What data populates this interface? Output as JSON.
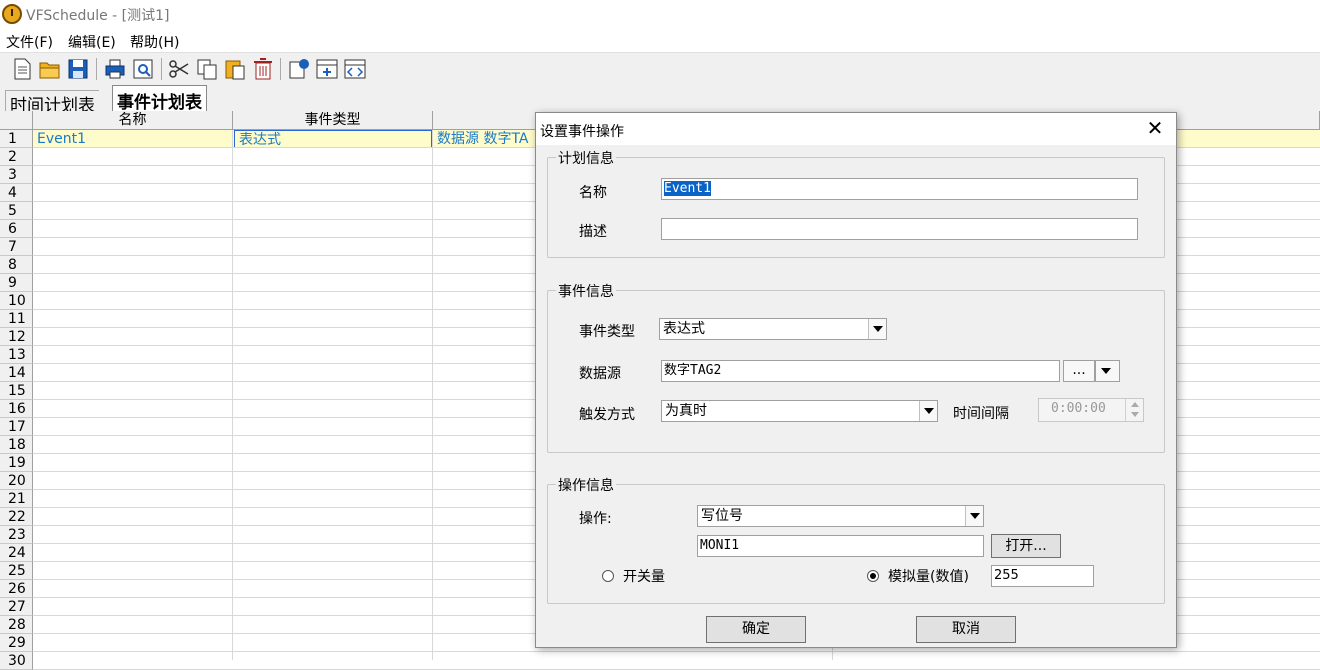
{
  "window": {
    "title": "VFSchedule - [测试1]"
  },
  "menu": {
    "items": [
      "文件(F)",
      "编辑(E)",
      "帮助(H)"
    ]
  },
  "toolbar": {
    "icons": [
      "new-icon",
      "open-icon",
      "save-icon",
      "print-icon",
      "print-preview-icon",
      "cut-icon",
      "copy-icon",
      "paste-icon",
      "delete-icon",
      "comment-icon",
      "add-row-icon",
      "code-icon"
    ]
  },
  "tabs": [
    "时间计划表",
    "事件计划表"
  ],
  "grid": {
    "columns": [
      "名称",
      "事件类型"
    ],
    "row_numbers": [
      "1",
      "2",
      "3",
      "4",
      "5",
      "6",
      "7",
      "8",
      "9",
      "10",
      "11",
      "12",
      "13",
      "14",
      "15",
      "16",
      "17",
      "18",
      "19",
      "20",
      "21",
      "22",
      "23",
      "24",
      "25",
      "26",
      "27",
      "28",
      "29",
      "30"
    ],
    "row1": {
      "name": "Event1",
      "type": "表达式",
      "source": "数据源 数字TA"
    }
  },
  "dialog": {
    "title": "设置事件操作",
    "plan_group": {
      "title": "计划信息",
      "name_label": "名称",
      "name_value": "Event1",
      "desc_label": "描述",
      "desc_value": ""
    },
    "event_group": {
      "title": "事件信息",
      "type_label": "事件类型",
      "type_value": "表达式",
      "source_label": "数据源",
      "source_value": "数字TAG2",
      "browse_label": "...",
      "trigger_label": "触发方式",
      "trigger_value": "为真时",
      "interval_label": "时间间隔",
      "interval_value": "0:00:00"
    },
    "op_group": {
      "title": "操作信息",
      "op_label": "操作:",
      "op_value": "写位号",
      "tag_value": "MONI1",
      "open_label": "打开...",
      "switch_label": "开关量",
      "analog_label": "模拟量(数值)",
      "analog_value": "255"
    },
    "ok_label": "确定",
    "cancel_label": "取消"
  }
}
